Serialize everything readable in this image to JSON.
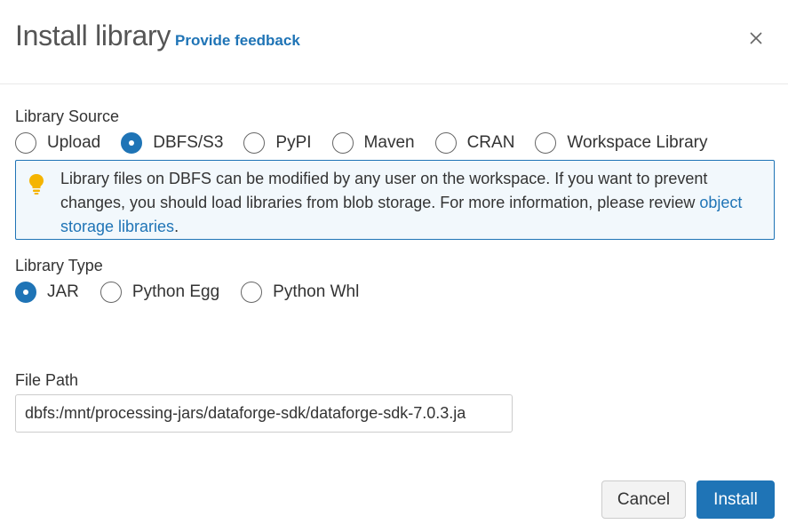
{
  "dialog": {
    "title": "Install library",
    "feedback_link": "Provide feedback",
    "close_icon": "close-icon"
  },
  "library_source": {
    "label": "Library Source",
    "selected": "DBFS/S3",
    "options": [
      "Upload",
      "DBFS/S3",
      "PyPI",
      "Maven",
      "CRAN",
      "Workspace Library"
    ]
  },
  "notice": {
    "icon": "lightbulb-icon",
    "text": "Library files on DBFS can be modified by any user on the workspace. If you want to prevent changes, you should load libraries from blob storage. For more information, please review ",
    "link": "object storage libraries",
    "suffix": "."
  },
  "library_type": {
    "label": "Library Type",
    "selected": "JAR",
    "options": [
      "JAR",
      "Python Egg",
      "Python Whl"
    ]
  },
  "file_path": {
    "label": "File Path",
    "value": "dbfs:/mnt/processing-jars/dataforge-sdk/dataforge-sdk-7.0.3.ja"
  },
  "footer": {
    "cancel_label": "Cancel",
    "install_label": "Install"
  },
  "colors": {
    "accent": "#1f74b6",
    "notice_background": "#f2f8fc",
    "lightbulb": "#f5b400"
  }
}
